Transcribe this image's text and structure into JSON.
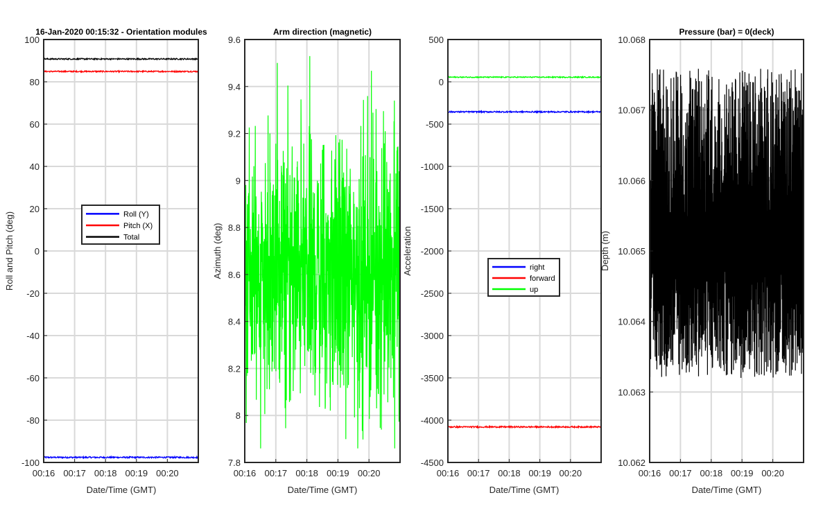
{
  "chart_data": [
    {
      "type": "line",
      "title": "16-Jan-2020 00:15:32 - Orientation modules",
      "xlabel": "Date/Time (GMT)",
      "ylabel": "Roll and Pitch (deg)",
      "xlim": [
        "00:16",
        "00:21"
      ],
      "xticks": [
        "00:16",
        "00:17",
        "00:18",
        "00:19",
        "00:20"
      ],
      "ylim": [
        -100,
        100
      ],
      "yticks": [
        "100",
        "80",
        "60",
        "40",
        "20",
        "0",
        "-20",
        "-40",
        "-60",
        "-80",
        "-100"
      ],
      "grid": true,
      "legend_position": "middle-center",
      "series": [
        {
          "name": "Roll (Y)",
          "color": "#0000ff",
          "mean": -97.6,
          "jitter": 0.35
        },
        {
          "name": "Pitch (X)",
          "color": "#ff0000",
          "mean": 84.9,
          "jitter": 0.3
        },
        {
          "name": "Total",
          "color": "#000000",
          "mean": 90.8,
          "jitter": 0.3
        }
      ]
    },
    {
      "type": "line",
      "title": "Arm direction (magnetic)",
      "xlabel": "Date/Time (GMT)",
      "ylabel": "Azimuth (deg)",
      "xlim": [
        "00:16",
        "00:21"
      ],
      "xticks": [
        "00:16",
        "00:17",
        "00:18",
        "00:19",
        "00:20"
      ],
      "ylim": [
        7.8,
        9.6
      ],
      "yticks": [
        "9.6",
        "9.4",
        "9.2",
        "9",
        "8.8",
        "8.6",
        "8.4",
        "8.2",
        "8",
        "7.8"
      ],
      "grid": true,
      "series": [
        {
          "color": "#00ff00",
          "mean": 8.6,
          "range": [
            7.86,
            9.6
          ],
          "noisy": true
        }
      ]
    },
    {
      "type": "line",
      "title": "",
      "xlabel": "Date/Time (GMT)",
      "ylabel": "Acceleration",
      "xlim": [
        "00:16",
        "00:21"
      ],
      "xticks": [
        "00:16",
        "00:17",
        "00:18",
        "00:19",
        "00:20"
      ],
      "ylim": [
        -4500,
        500
      ],
      "yticks": [
        "500",
        "0",
        "-500",
        "-1000",
        "-1500",
        "-2000",
        "-2500",
        "-3000",
        "-3500",
        "-4000",
        "-4500"
      ],
      "grid": true,
      "legend_position": "lower-center",
      "series": [
        {
          "name": "right",
          "color": "#0000ff",
          "mean": -355,
          "jitter": 8
        },
        {
          "name": "forward",
          "color": "#ff0000",
          "mean": -4080,
          "jitter": 8
        },
        {
          "name": "up",
          "color": "#00ff00",
          "mean": 55,
          "jitter": 6
        }
      ]
    },
    {
      "type": "line",
      "title": "Pressure (bar) = 0(deck)",
      "xlabel": "Date/Time (GMT)",
      "ylabel": "Depth (m)",
      "xlim": [
        "00:16",
        "00:21"
      ],
      "xticks": [
        "00:16",
        "00:17",
        "00:18",
        "00:19",
        "00:20"
      ],
      "ylim": [
        10.062,
        10.068
      ],
      "yticks": [
        "10.068",
        "10.067",
        "10.066",
        "10.065",
        "10.064",
        "10.063",
        "10.062"
      ],
      "grid": true,
      "series": [
        {
          "color": "#000000",
          "range": [
            10.0632,
            10.0676
          ],
          "noisy": true
        }
      ]
    }
  ]
}
